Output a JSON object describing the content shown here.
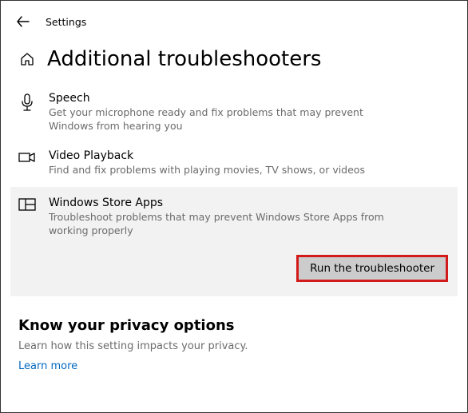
{
  "header": {
    "title": "Settings"
  },
  "page": {
    "title": "Additional troubleshooters"
  },
  "items": [
    {
      "title": "Speech",
      "desc": "Get your microphone ready and fix problems that may prevent Windows from hearing you"
    },
    {
      "title": "Video Playback",
      "desc": "Find and fix problems with playing movies, TV shows, or videos"
    },
    {
      "title": "Windows Store Apps",
      "desc": "Troubleshoot problems that may prevent Windows Store Apps from working properly"
    }
  ],
  "run_button": "Run the troubleshooter",
  "privacy": {
    "heading": "Know your privacy options",
    "desc": "Learn how this setting impacts your privacy.",
    "link": "Learn more"
  }
}
